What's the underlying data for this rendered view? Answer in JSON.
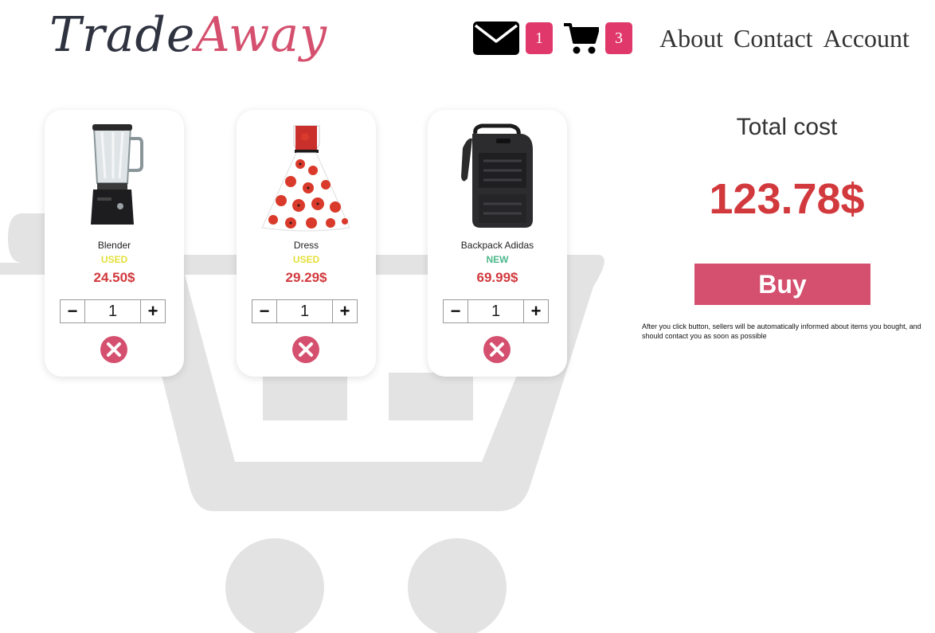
{
  "header": {
    "logo_part1": "Trade",
    "logo_part2": "Away",
    "messages_count": "1",
    "cart_count": "3",
    "nav": [
      "About",
      "Contact",
      "Account"
    ]
  },
  "cart": {
    "items": [
      {
        "name": "Blender",
        "condition": "USED",
        "price": "24.50$",
        "quantity": "1"
      },
      {
        "name": "Dress",
        "condition": "USED",
        "price": "29.29$",
        "quantity": "1"
      },
      {
        "name": "Backpack Adidas",
        "condition": "NEW",
        "price": "69.99$",
        "quantity": "1"
      }
    ],
    "decrement_symbol": "−",
    "increment_symbol": "+"
  },
  "summary": {
    "total_label": "Total cost",
    "total_value": "123.78$",
    "buy_label": "Buy",
    "note": "After you click button, sellers will be automatically informed about items you bought, and should contact you as soon as possible"
  },
  "colors": {
    "accent": "#d4506e",
    "badge": "#e0386a",
    "price": "#d2393d",
    "used": "#e4e03a",
    "new": "#4bb88a",
    "background_cart": "#e3e3e3"
  }
}
